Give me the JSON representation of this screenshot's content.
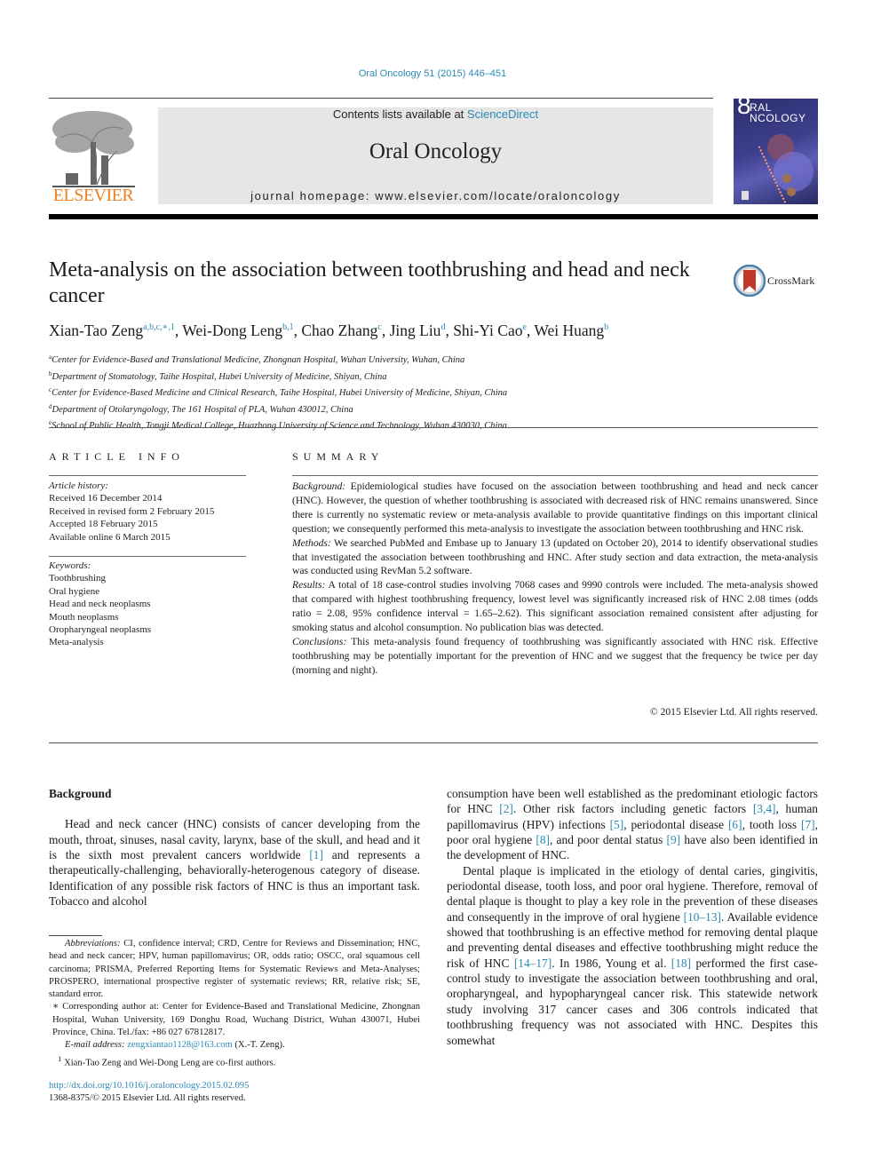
{
  "header": {
    "citation": "Oral Oncology 51 (2015) 446–451",
    "contents_prefix": "Contents lists available at ",
    "contents_link": "ScienceDirect",
    "journal_name": "Oral Oncology",
    "homepage": "journal homepage: www.elsevier.com/locate/oraloncology",
    "publisher_logo_text": "ELSEVIER",
    "cover": {
      "title_line1": "RAL",
      "title_line2": "NCOLOGY",
      "big_letter": "8"
    },
    "colors": {
      "link": "#2a8ab5",
      "elsevier_orange": "#f07f1e",
      "banner_bg": "#e6e6e6"
    }
  },
  "article": {
    "title": "Meta-analysis on the association between toothbrushing and head and neck cancer",
    "crossmark_label": "CrossMark",
    "authors": [
      {
        "name": "Xian-Tao Zeng",
        "sup": "a,b,c,∗,1"
      },
      {
        "name": "Wei-Dong Leng",
        "sup": "b,1"
      },
      {
        "name": "Chao Zhang",
        "sup": "c"
      },
      {
        "name": "Jing Liu",
        "sup": "d"
      },
      {
        "name": "Shi-Yi Cao",
        "sup": "e"
      },
      {
        "name": "Wei Huang",
        "sup": "b"
      }
    ],
    "affiliations": [
      {
        "key": "a",
        "text": "Center for Evidence-Based and Translational Medicine, Zhongnan Hospital, Wuhan University, Wuhan, China"
      },
      {
        "key": "b",
        "text": "Department of Stomatology, Taihe Hospital, Hubei University of Medicine, Shiyan, China"
      },
      {
        "key": "c",
        "text": "Center for Evidence-Based Medicine and Clinical Research, Taihe Hospital, Hubei University of Medicine, Shiyan, China"
      },
      {
        "key": "d",
        "text": "Department of Otolaryngology, The 161 Hospital of PLA, Wuhan 430012, China"
      },
      {
        "key": "e",
        "text": "School of Public Health, Tongji Medical College, Huazhong University of Science and Technology, Wuhan 430030, China"
      }
    ]
  },
  "article_info": {
    "heading": "ARTICLE INFO",
    "history_label": "Article history:",
    "history": [
      "Received 16 December 2014",
      "Received in revised form 2 February 2015",
      "Accepted 18 February 2015",
      "Available online 6 March 2015"
    ],
    "keywords_label": "Keywords:",
    "keywords": [
      "Toothbrushing",
      "Oral hygiene",
      "Head and neck neoplasms",
      "Mouth neoplasms",
      "Oropharyngeal neoplasms",
      "Meta-analysis"
    ]
  },
  "summary": {
    "heading": "SUMMARY",
    "sections": [
      {
        "label": "Background:",
        "text": " Epidemiological studies have focused on the association between toothbrushing and head and neck cancer (HNC). However, the question of whether toothbrushing is associated with decreased risk of HNC remains unanswered. Since there is currently no systematic review or meta-analysis available to provide quantitative findings on this important clinical question; we consequently performed this meta-analysis to investigate the association between toothbrushing and HNC risk."
      },
      {
        "label": "Methods:",
        "text": " We searched PubMed and Embase up to January 13 (updated on October 20), 2014 to identify observational studies that investigated the association between toothbrushing and HNC. After study section and data extraction, the meta-analysis was conducted using RevMan 5.2 software."
      },
      {
        "label": "Results:",
        "text": " A total of 18 case-control studies involving 7068 cases and 9990 controls were included. The meta-analysis showed that compared with highest toothbrushing frequency, lowest level was significantly increased risk of HNC 2.08 times (odds ratio = 2.08, 95% confidence interval = 1.65–2.62). This significant association remained consistent after adjusting for smoking status and alcohol consumption. No publication bias was detected."
      },
      {
        "label": "Conclusions:",
        "text": " This meta-analysis found frequency of toothbrushing was significantly associated with HNC risk. Effective toothbrushing may be potentially important for the prevention of HNC and we suggest that the frequency be twice per day (morning and night)."
      }
    ],
    "copyright": "© 2015 Elsevier Ltd. All rights reserved."
  },
  "body": {
    "section_heading": "Background",
    "left_para": [
      {
        "t": "Head and neck cancer (HNC) consists of cancer developing from the mouth, throat, sinuses, nasal cavity, larynx, base of the skull, and head and it is the sixth most prevalent cancers worldwide "
      },
      {
        "ref": "[1]"
      },
      {
        "t": " and represents a therapeutically-challenging, behaviorally-heterogenous category of disease. Identification of any possible risk factors of HNC is thus an important task. Tobacco and alcohol"
      }
    ],
    "right_para1": [
      {
        "t": "consumption have been well established as the predominant etiologic factors for HNC "
      },
      {
        "ref": "[2]"
      },
      {
        "t": ". Other risk factors including genetic factors "
      },
      {
        "ref": "[3,4]"
      },
      {
        "t": ", human papillomavirus (HPV) infections "
      },
      {
        "ref": "[5]"
      },
      {
        "t": ", periodontal disease "
      },
      {
        "ref": "[6]"
      },
      {
        "t": ", tooth loss "
      },
      {
        "ref": "[7]"
      },
      {
        "t": ", poor oral hygiene "
      },
      {
        "ref": "[8]"
      },
      {
        "t": ", and poor dental status "
      },
      {
        "ref": "[9]"
      },
      {
        "t": " have also been identified in the development of HNC."
      }
    ],
    "right_para2": [
      {
        "t": "Dental plaque is implicated in the etiology of dental caries, gingivitis, periodontal disease, tooth loss, and poor oral hygiene. Therefore, removal of dental plaque is thought to play a key role in the prevention of these diseases and consequently in the improve of oral hygiene "
      },
      {
        "ref": "[10–13]"
      },
      {
        "t": ". Available evidence showed that toothbrushing is an effective method for removing dental plaque and preventing dental diseases and effective toothbrushing might reduce the risk of HNC "
      },
      {
        "ref": "[14–17]"
      },
      {
        "t": ". In 1986, Young et al. "
      },
      {
        "ref": "[18]"
      },
      {
        "t": " performed the first case-control study to investigate the association between toothbrushing and oral, oropharyngeal, and hypopharyngeal cancer risk. This statewide network study involving 317 cancer cases and 306 controls indicated that toothbrushing frequency was not associated with HNC. Despites this somewhat"
      }
    ]
  },
  "footnotes": {
    "abbrev_label": "Abbreviations:",
    "abbrev_text": " CI, confidence interval; CRD, Centre for Reviews and Dissemination; HNC, head and neck cancer; HPV, human papillomavirus; OR, odds ratio; OSCC, oral squamous cell carcinoma; PRISMA, Preferred Reporting Items for Systematic Reviews and Meta-Analyses; PROSPERO, international prospective register of systematic reviews; RR, relative risk; SE, standard error.",
    "corresponding": "∗ Corresponding author at: Center for Evidence-Based and Translational Medicine, Zhongnan Hospital, Wuhan University, 169 Donghu Road, Wuchang District, Wuhan 430071, Hubei Province, China. Tel./fax: +86 027 67812817.",
    "email_label": "E-mail address:",
    "email": "zengxiantao1128@163.com",
    "email_suffix": " (X.-T. Zeng).",
    "cofirst_mark": "1",
    "cofirst": " Xian-Tao Zeng and Wei-Dong Leng are co-first authors."
  },
  "doi": {
    "link": "http://dx.doi.org/10.1016/j.oraloncology.2015.02.095",
    "issn": "1368-8375/© 2015 Elsevier Ltd. All rights reserved."
  }
}
